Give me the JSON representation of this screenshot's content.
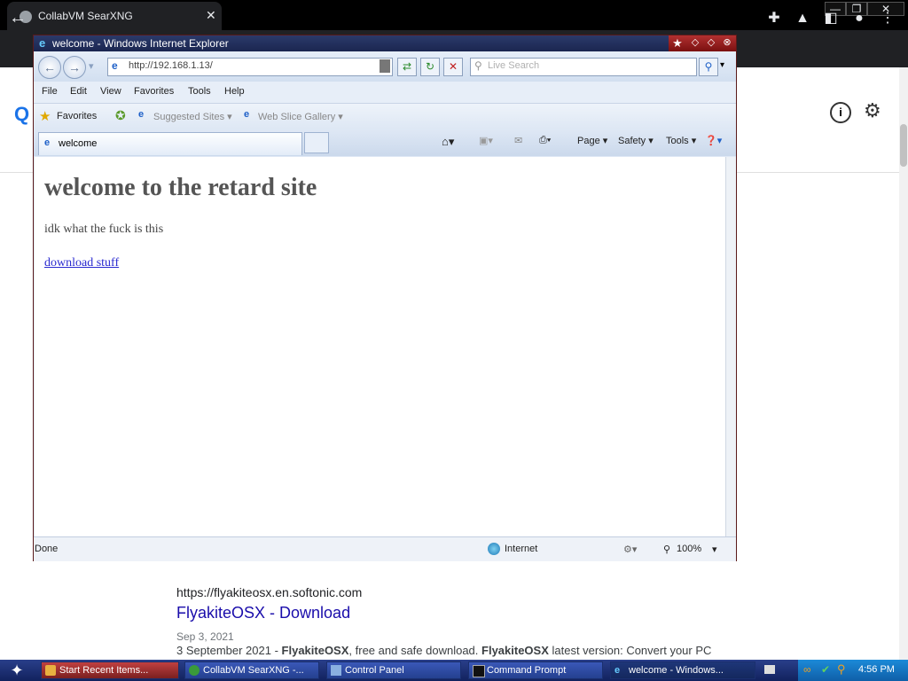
{
  "chrome": {
    "tab_title": "CollabVM SearXNG",
    "tab_close": "✕",
    "window_controls": [
      "—",
      "❐",
      "✕"
    ],
    "toolbar_icons": [
      "puzzle-icon",
      "flask-icon",
      "sidepanel-icon",
      "profile-icon",
      "more-icon"
    ]
  },
  "searx": {
    "info_label": "i",
    "result": {
      "url": "https://flyakiteosx.en.softonic.com",
      "title": "FlyakiteOSX - Download",
      "date": "Sep 3, 2021",
      "snippet_prefix": "3 September 2021 - ",
      "snippet_bold_1": "FlyakiteOSX",
      "snippet_mid": ", free and safe download. ",
      "snippet_bold_2": "FlyakiteOSX",
      "snippet_suffix": " latest version: Convert your PC"
    }
  },
  "ie": {
    "window_title": "welcome - Windows Internet Explorer",
    "address": "http://192.168.1.13/",
    "search_placeholder": "Live Search",
    "menu": [
      "File",
      "Edit",
      "View",
      "Favorites",
      "Tools",
      "Help"
    ],
    "favorites_label": "Favorites",
    "suggested_sites": "Suggested Sites ▾",
    "web_slice": "Web Slice Gallery ▾",
    "tab_title": "welcome",
    "commands": {
      "page": "Page ▾",
      "safety": "Safety ▾",
      "tools": "Tools ▾"
    },
    "status": {
      "left": "Done",
      "zone": "Internet",
      "zoom": "100%"
    }
  },
  "page": {
    "heading": "welcome to the retard site",
    "text": "idk what the fuck is this",
    "link": "download stuff"
  },
  "taskbar": {
    "items": [
      "Start Recent Items...",
      "CollabVM SearXNG -...",
      "Control Panel",
      "Command Prompt",
      "welcome - Windows..."
    ],
    "clock": "4:56 PM"
  }
}
